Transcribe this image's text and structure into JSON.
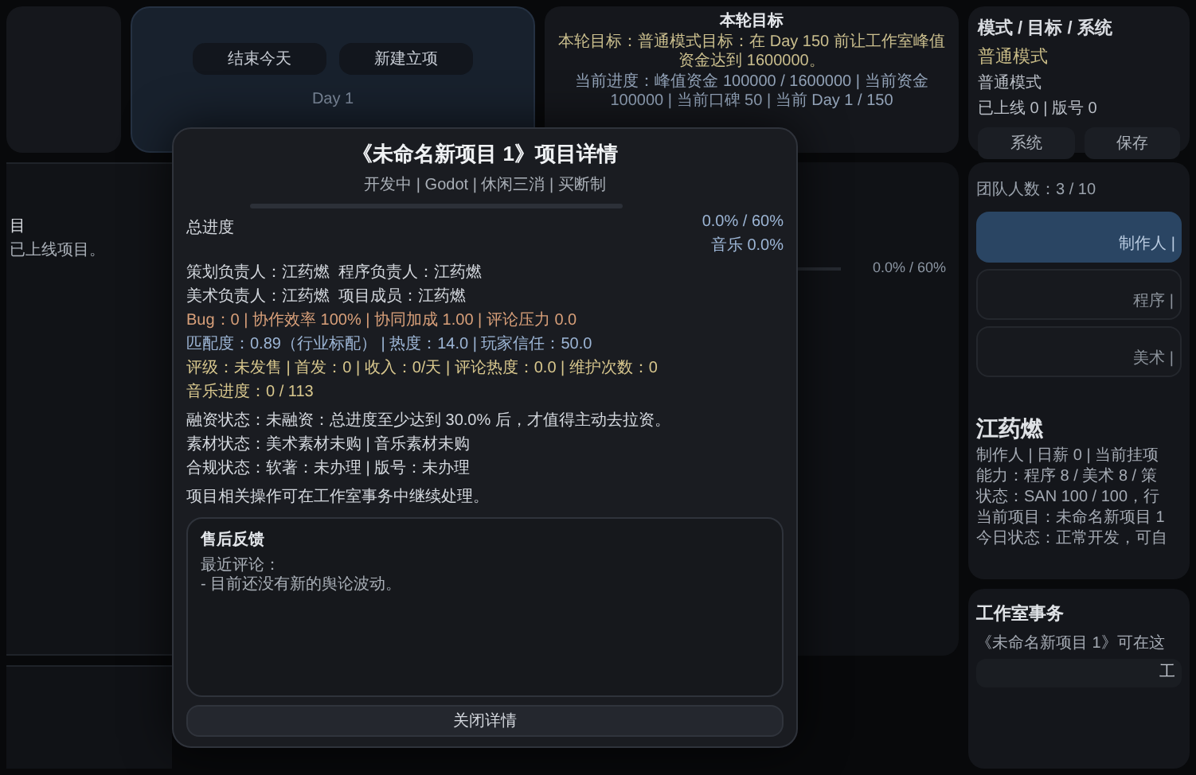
{
  "top_bar": {
    "buttons": [
      "结束今天",
      "新建立项"
    ],
    "day": "Day 1"
  },
  "goal_card": {
    "title": "本轮目标",
    "goal": "本轮目标：普通模式目标：在 Day 150 前让工作室峰值资金达到 1600000。",
    "progress": "当前进度：峰值资金 100000 / 1600000 | 当前资金 100000 | 当前口碑 50 | 当前 Day 1 / 150"
  },
  "mode_card": {
    "title": "模式 / 目标 / 系统",
    "mode": "普通模式",
    "mode_detail": "普通模式",
    "stats": "已上线 0 | 版号 0",
    "buttons": [
      "系统",
      "保存"
    ]
  },
  "left_panel": {
    "heading": "目",
    "text": "已上线项目。"
  },
  "middle_panel": {
    "reading": "0.0% / 60%",
    "level": 0
  },
  "team_panel": {
    "count": "团队人数：3 / 10",
    "members": [
      {
        "label": "制作人 |",
        "selected": true
      },
      {
        "label": "程序 |",
        "selected": false
      },
      {
        "label": "美术 |",
        "selected": false
      }
    ],
    "person": {
      "name": "江药燃",
      "lines": [
        "制作人 | 日薪 0 | 当前挂项",
        "能力：程序 8 / 美术 8 / 策",
        "状态：SAN 100 / 100，行",
        "当前项目：未命名新项目 1",
        "今日状态：正常开发，可自"
      ]
    }
  },
  "studio_panel": {
    "title": "工作室事务",
    "text": "《未命名新项目 1》可在这",
    "buttons": [
      "工"
    ]
  },
  "dialog": {
    "title": "《未命名新项目 1》项目详情",
    "subtitle": "开发中 | Godot | 休闲三消 | 买断制",
    "progress": {
      "label": "总进度",
      "level": 0,
      "reading": "0.0% / 60%",
      "music": "音乐 0.0%"
    },
    "groups": [
      [
        {
          "text": "策划负责人：江药燃  程序负责人：江药燃",
          "kind": "plain"
        },
        {
          "text": "美术负责人：江药燃  项目成员：江药燃",
          "kind": "plain"
        },
        {
          "text": "Bug：0 | 协作效率 100% | 协同加成 1.00 | 评论压力 0.0",
          "kind": "warning"
        },
        {
          "text": "匹配度：0.89（行业标配） | 热度：14.0 | 玩家信任：50.0",
          "kind": "info"
        },
        {
          "text": "评级：未发售 | 首发：0 | 收入：0/天 | 评论热度：0.0 | 维护次数：0",
          "kind": "highlight"
        },
        {
          "text": "音乐进度：0 / 113",
          "kind": "highlight"
        }
      ],
      [
        {
          "text": "融资状态：未融资：总进度至少达到 30.0% 后，才值得主动去拉资。",
          "kind": "plain"
        },
        {
          "text": "素材状态：美术素材未购 | 音乐素材未购",
          "kind": "plain"
        },
        {
          "text": "合规状态：软著：未办理 | 版号：未办理",
          "kind": "plain"
        }
      ],
      [
        {
          "text": "项目相关操作可在工作室事务中继续处理。",
          "kind": "plain"
        }
      ]
    ],
    "feedback": {
      "title": "售后反馈",
      "lines": [
        "最近评论：",
        "- 目前还没有新的舆论波动。"
      ]
    },
    "close_button": "关闭详情"
  }
}
